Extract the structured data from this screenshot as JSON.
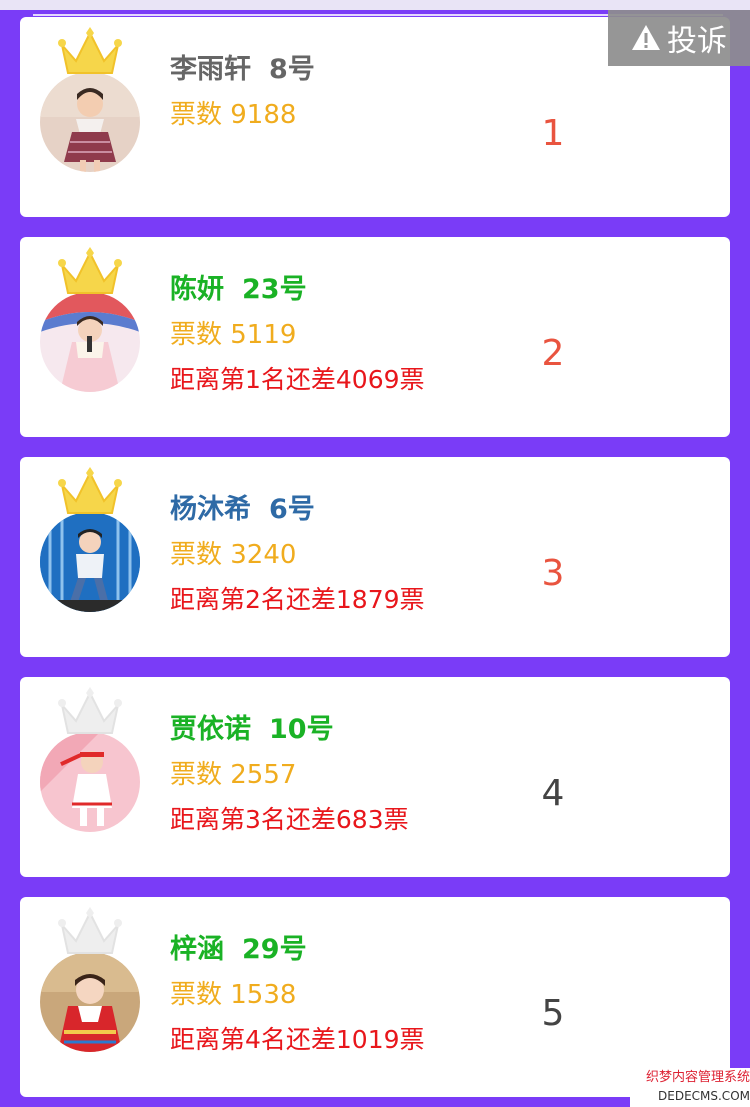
{
  "complaint": {
    "label": "投诉",
    "icon": "warning-icon"
  },
  "entries": [
    {
      "name": "李雨轩",
      "number": "8号",
      "votes": "票数 9188",
      "gap": "",
      "rank": "1",
      "name_color": "#666666",
      "rank_color": "#e9543f",
      "crown": "gold"
    },
    {
      "name": "陈妍",
      "number": "23号",
      "votes": "票数 5119",
      "gap": "距离第1名还差4069票",
      "rank": "2",
      "name_color": "#1ab225",
      "rank_color": "#e9543f",
      "crown": "gold"
    },
    {
      "name": "杨沐希",
      "number": "6号",
      "votes": "票数 3240",
      "gap": "距离第2名还差1879票",
      "rank": "3",
      "name_color": "#2e6aa6",
      "rank_color": "#e9543f",
      "crown": "gold"
    },
    {
      "name": "贾依诺",
      "number": "10号",
      "votes": "票数 2557",
      "gap": "距离第3名还差683票",
      "rank": "4",
      "name_color": "#1ab225",
      "rank_color": "#444444",
      "crown": "gray"
    },
    {
      "name": "梓涵",
      "number": "29号",
      "votes": "票数 1538",
      "gap": "距离第4名还差1019票",
      "rank": "5",
      "name_color": "#1ab225",
      "rank_color": "#444444",
      "crown": "gray"
    }
  ],
  "watermark": {
    "line1": "织梦内容管理系统",
    "line2": "DEDECMS.COM"
  }
}
